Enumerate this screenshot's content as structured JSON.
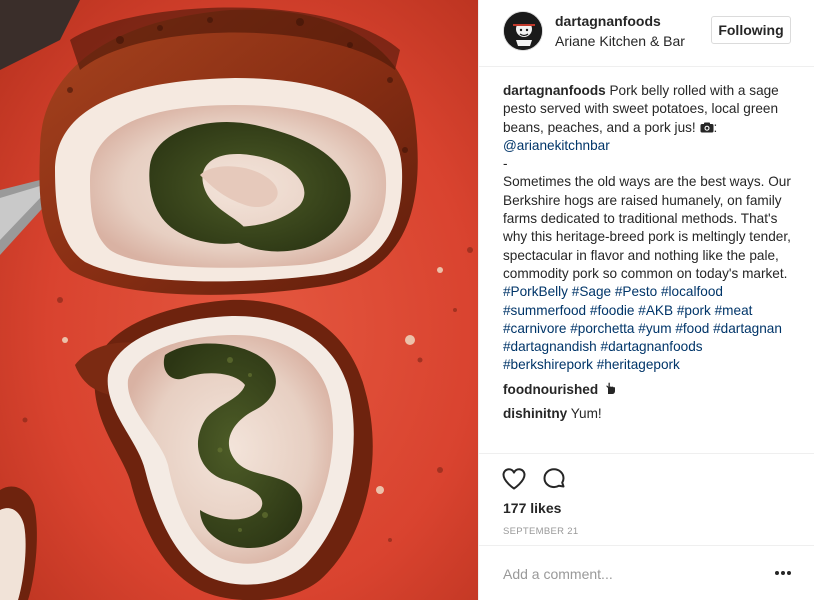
{
  "post": {
    "image_alt": "Rolled pork belly with sage pesto on a red cutting board"
  },
  "header": {
    "username": "dartagnanfoods",
    "location": "Ariane Kitchen & Bar",
    "follow_label": "Following"
  },
  "caption": {
    "username": "dartagnanfoods",
    "text_1": " Pork belly rolled with a sage pesto served with sweet potatoes, local green beans, peaches, and a pork jus! ",
    "camera_icon": "camera-icon",
    "text_2": ":",
    "mention": "@arianekitchnbar",
    "dash": "-",
    "body": "Sometimes the old ways are the best ways. Our Berkshire hogs are raised humanely, on family farms dedicated to traditional methods. That's why this heritage-breed pork is meltingly tender, spectacular in flavor and nothing like the pale, commodity pork so common on today's market. ",
    "hashtags": [
      "#PorkBelly",
      "#Sage",
      "#Pesto",
      "#localfood",
      "#summerfood",
      "#foodie",
      "#AKB",
      "#pork",
      "#meat",
      "#carnivore",
      "#porchetta",
      "#yum",
      "#food",
      "#dartagnan",
      "#dartagnandish",
      "#dartagnanfoods",
      "#berkshirepork",
      "#heritagepork"
    ]
  },
  "comments": [
    {
      "username": "foodnourished",
      "text": "",
      "emoji_icon": "pointing-hand-icon"
    },
    {
      "username": "dishinitny",
      "text": " Yum!"
    }
  ],
  "actions": {
    "like_icon": "heart-icon",
    "comment_icon": "comment-bubble-icon",
    "likes": "177 likes",
    "date": "SEPTEMBER 21"
  },
  "add_comment": {
    "placeholder": "Add a comment...",
    "more_icon": "more-options-icon"
  },
  "colors": {
    "link": "#003569",
    "border": "#efefef",
    "muted": "#999999",
    "text": "#262626"
  }
}
